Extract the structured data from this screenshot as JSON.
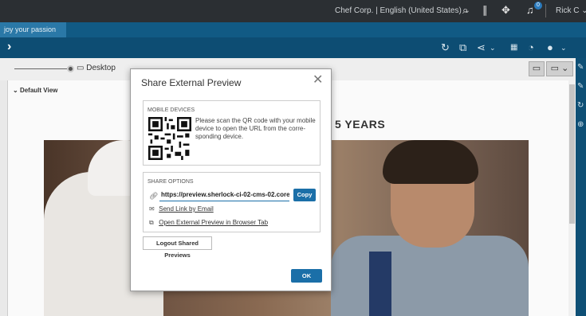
{
  "topbar": {
    "org_locale": "Chef Corp. | English (United States)",
    "user": "Rick C",
    "notification_count": "0",
    "icons": [
      "chevron-down-icon",
      "search-icon",
      "sign-icon",
      "workflow-icon",
      "notification-bell-icon",
      "chevron-down-icon"
    ]
  },
  "tabstrip": {
    "tab_label": "joy your passion"
  },
  "toolbar": {
    "icons": [
      "expand-icon",
      "refresh-icon",
      "open-external-icon",
      "share-icon",
      "chevron-down-icon",
      "storage-icon",
      "clock-icon",
      "user-icon",
      "chevron-down-icon"
    ]
  },
  "device_bar": {
    "label": "Desktop"
  },
  "canvas": {
    "default_view": "Default View",
    "headline": "5 YEARS"
  },
  "modal": {
    "title": "Share External Preview",
    "mobile": {
      "section_title": "MOBILE DEVICES",
      "instructions": "Please scan the QR code with your mobile device to open the URL from the corre-sponding device."
    },
    "share": {
      "section_title": "SHARE OPTIONS",
      "url": "https://preview.sherlock-ci-02-cms-02.coremedia",
      "copy_label": "Copy",
      "email_label": "Send Link by Email",
      "open_label": "Open External Preview in Browser Tab"
    },
    "logout_label": "Logout Shared Previews",
    "ok_label": "OK"
  },
  "colors": {
    "topbar": "#2b2f33",
    "tabstrip": "#115a84",
    "toolbar": "#0d4d73",
    "accent": "#1b6fa8"
  }
}
